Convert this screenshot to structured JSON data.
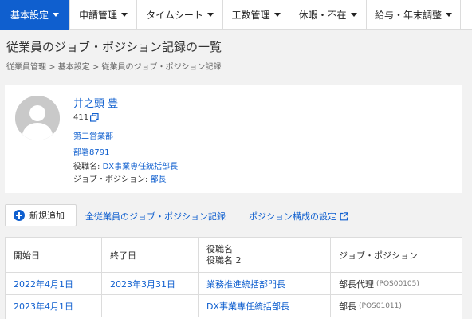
{
  "nav": {
    "items": [
      {
        "label": "基本設定"
      },
      {
        "label": "申請管理"
      },
      {
        "label": "タイムシート"
      },
      {
        "label": "工数管理"
      },
      {
        "label": "休暇・不在"
      },
      {
        "label": "給与・年末調整"
      }
    ]
  },
  "page": {
    "title": "従業員のジョブ・ポジション記録の一覧",
    "breadcrumb": "従業員管理 > 基本設定 > 従業員のジョブ・ポジション記録"
  },
  "profile": {
    "name": "井之頭 豊",
    "employee_id": "411",
    "department": "第二営業部",
    "section": "部署8791",
    "role_label": "役職名:",
    "role_value": "DX事業専任統括部長",
    "job_label": "ジョブ・ポジション:",
    "job_value": "部長"
  },
  "actions": {
    "new_label": "新規追加",
    "all_records_link": "全従業員のジョブ・ポジション記録",
    "structure_link": "ポジション構成の設定"
  },
  "table": {
    "headers": {
      "start": "開始日",
      "end": "終了日",
      "role1": "役職名",
      "role2": "役職名 2",
      "job": "ジョブ・ポジション"
    },
    "rows": [
      {
        "start": "2022年4月1日",
        "end": "2023年3月31日",
        "role": "業務推進統括部門長",
        "job": "部長代理",
        "code": "(POS00105)"
      },
      {
        "start": "2023年4月1日",
        "end": "",
        "role": "DX事業専任統括部長",
        "job": "部長",
        "code": "(POS01011)"
      }
    ]
  },
  "colors": {
    "accent": "#0f5fcf",
    "background": "#f2f2f2"
  }
}
